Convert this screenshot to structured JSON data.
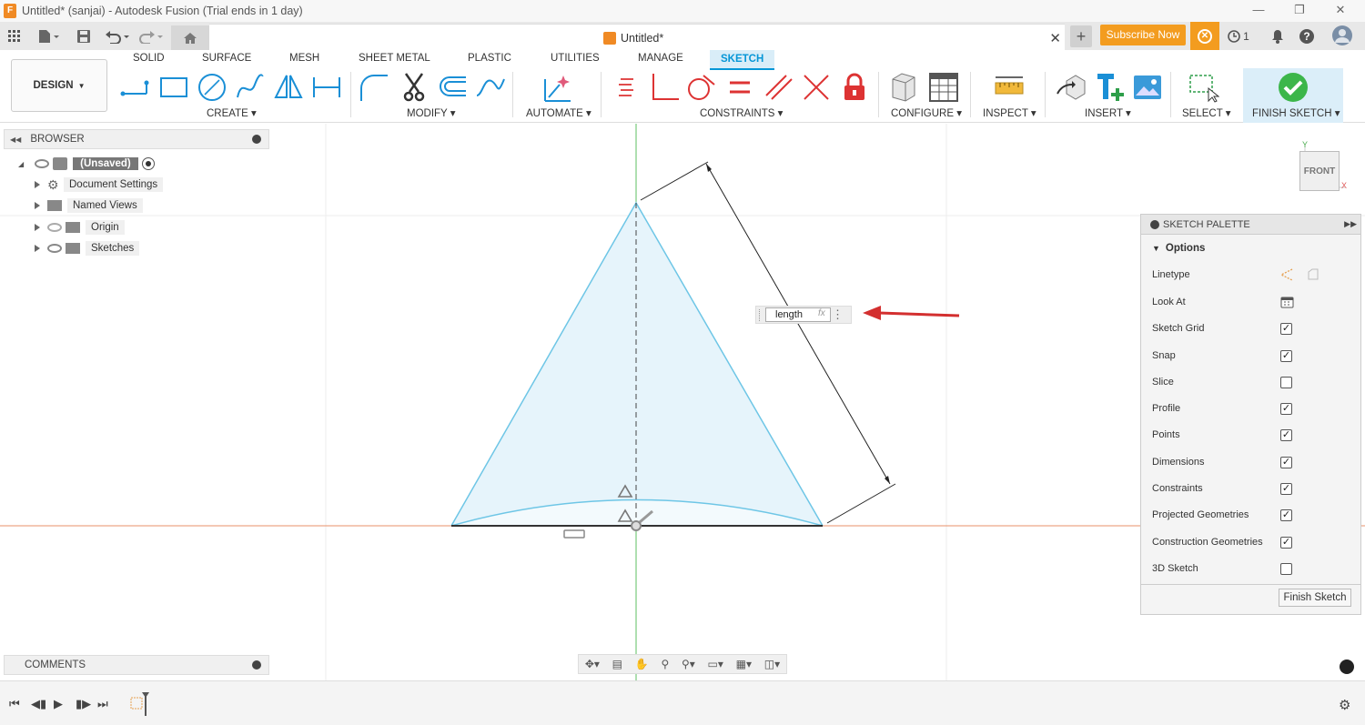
{
  "window": {
    "title": "Untitled* (sanjai) - Autodesk Fusion (Trial ends in 1 day)",
    "app_icon": "F"
  },
  "toolbar": {
    "doc_tab_title": "Untitled*",
    "subscribe_label": "Subscribe Now",
    "job_count": "1"
  },
  "ribbon": {
    "workspace": "DESIGN",
    "tabs": [
      "SOLID",
      "SURFACE",
      "MESH",
      "SHEET METAL",
      "PLASTIC",
      "UTILITIES",
      "MANAGE",
      "SKETCH"
    ],
    "active_tab": "SKETCH",
    "groups": [
      "CREATE",
      "MODIFY",
      "AUTOMATE",
      "CONSTRAINTS",
      "CONFIGURE",
      "INSPECT",
      "INSERT",
      "SELECT",
      "FINISH SKETCH"
    ]
  },
  "browser": {
    "title": "BROWSER",
    "root": "(Unsaved)",
    "items": [
      "Document Settings",
      "Named Views",
      "Origin",
      "Sketches"
    ]
  },
  "comments": {
    "title": "COMMENTS"
  },
  "viewcube": {
    "face": "FRONT",
    "axis_y": "Y",
    "axis_x": "X"
  },
  "dimension_input": {
    "value": "length",
    "fx": "fx"
  },
  "sketch_palette": {
    "title": "SKETCH PALETTE",
    "section": "Options",
    "rows": [
      {
        "label": "Linetype",
        "type": "icons"
      },
      {
        "label": "Look At",
        "type": "icon"
      },
      {
        "label": "Sketch Grid",
        "checked": true
      },
      {
        "label": "Snap",
        "checked": true
      },
      {
        "label": "Slice",
        "checked": false
      },
      {
        "label": "Profile",
        "checked": true
      },
      {
        "label": "Points",
        "checked": true
      },
      {
        "label": "Dimensions",
        "checked": true
      },
      {
        "label": "Constraints",
        "checked": true
      },
      {
        "label": "Projected Geometries",
        "checked": true
      },
      {
        "label": "Construction Geometries",
        "checked": true
      },
      {
        "label": "3D Sketch",
        "checked": false
      }
    ],
    "finish_label": "Finish Sketch"
  },
  "colors": {
    "accent": "#0696d7",
    "subscribe": "#f39c1f",
    "sketch_line": "#6ec6e6",
    "sketch_fill": "#e6f4fb",
    "x_axis": "#e8906a",
    "y_axis": "#4caf50",
    "arrow": "#d32f2f"
  }
}
